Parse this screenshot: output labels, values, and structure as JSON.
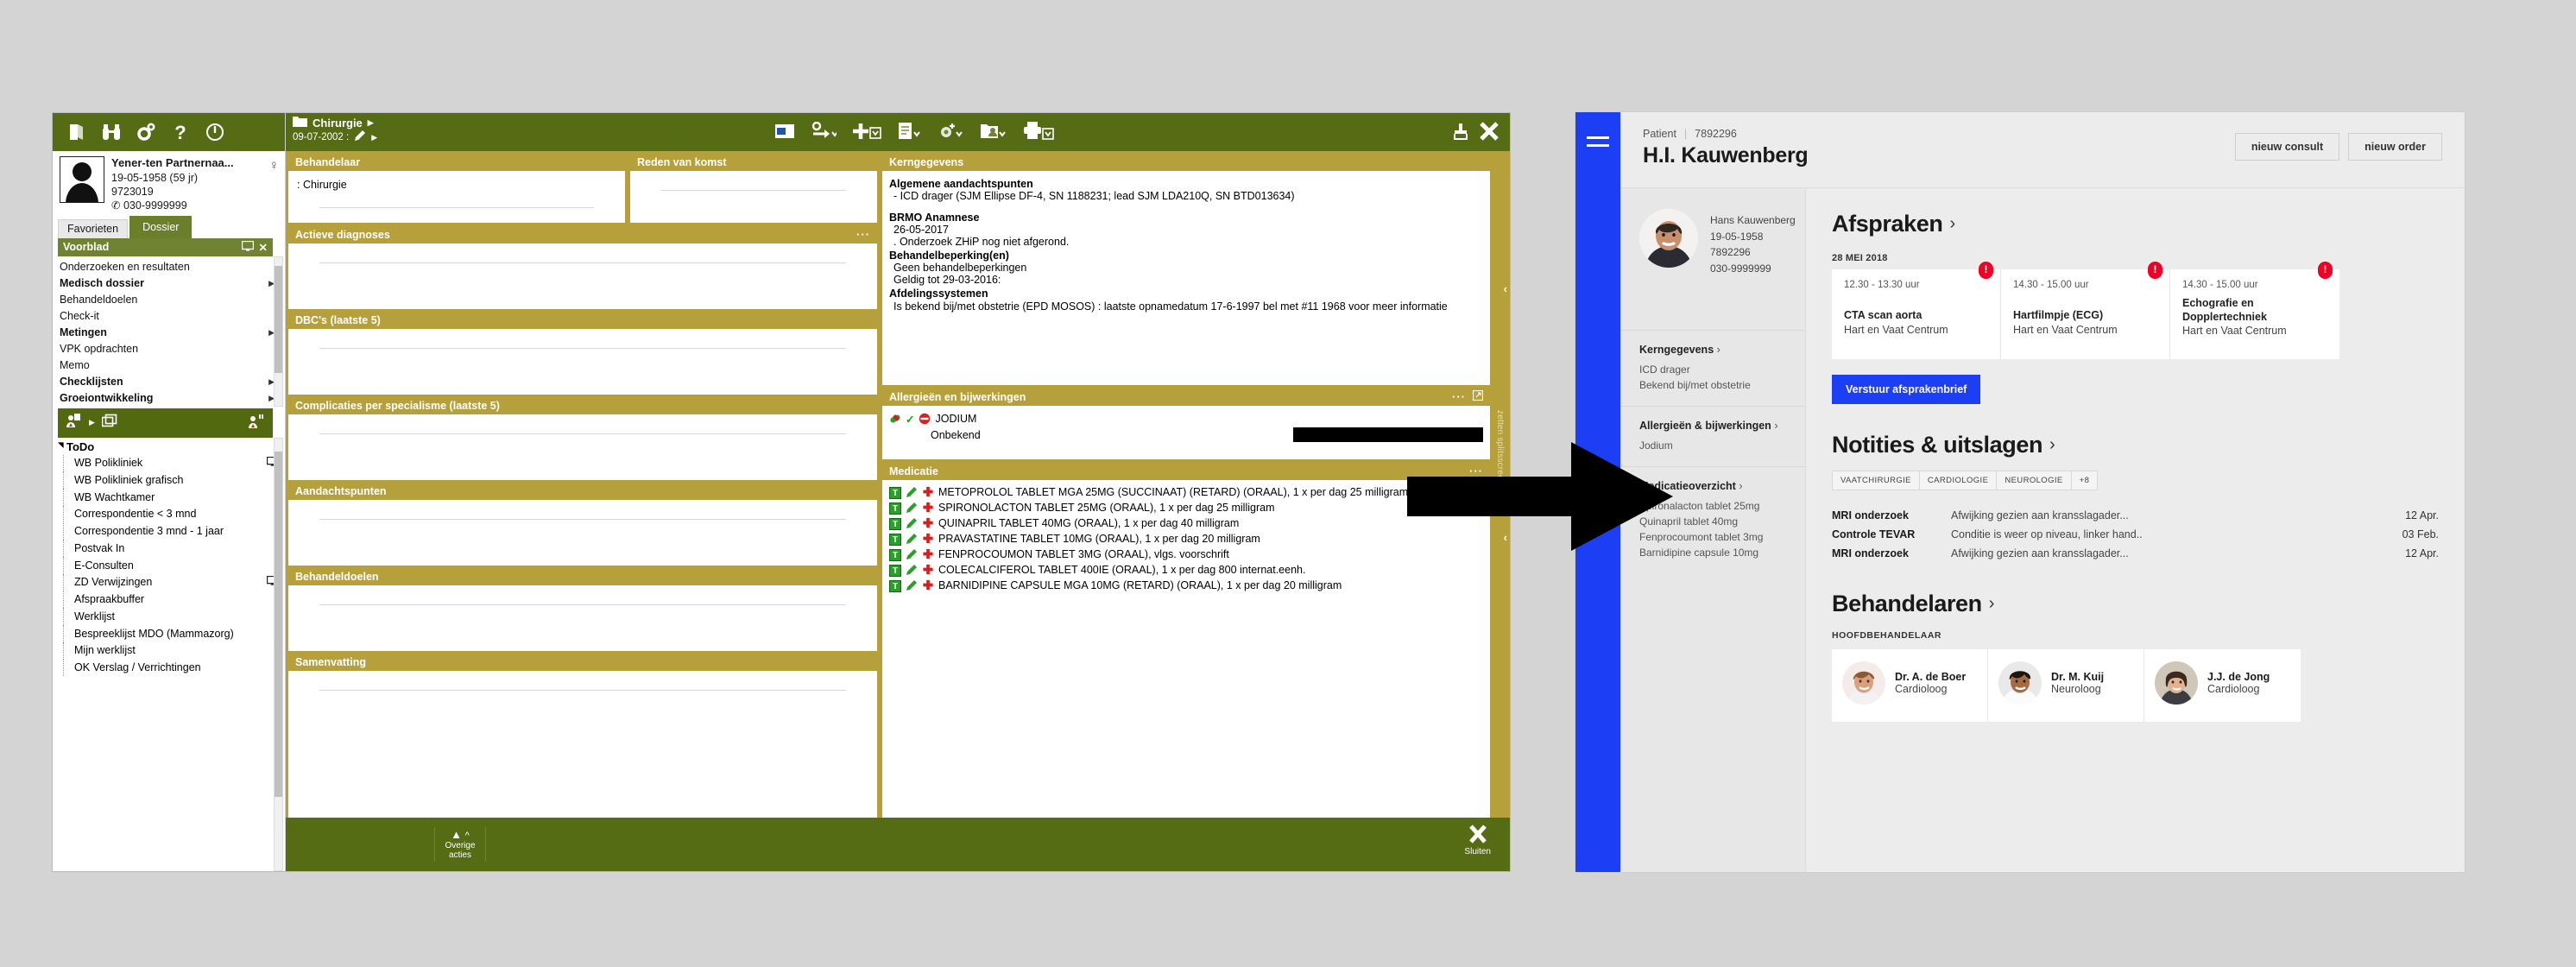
{
  "legacy": {
    "toolbar_icons": [
      "book-icon",
      "binoculars-icon",
      "gears-icon",
      "help-icon",
      "power-icon"
    ],
    "patient": {
      "name": "Yener-ten Partnernaa...",
      "dob": "19-05-1958 (59 jr)",
      "id": "9723019",
      "phone": "030-9999999",
      "phone_icon": "phone-icon",
      "gender_icon": "female-icon",
      "avatar": "patient-silhouette-avatar"
    },
    "tabs": [
      {
        "label": "Favorieten",
        "active": false
      },
      {
        "label": "Dossier",
        "active": true
      }
    ],
    "panel_header": {
      "title": "Voorblad",
      "screen_icon": "monitor-icon",
      "close_icon": "close-icon"
    },
    "nav_items": [
      {
        "label": "Onderzoeken en resultaten",
        "bold": false,
        "arrow": false
      },
      {
        "label": "Medisch dossier",
        "bold": true,
        "arrow": true
      },
      {
        "label": "Behandeldoelen",
        "bold": false,
        "arrow": false
      },
      {
        "label": "Check-it",
        "bold": false,
        "arrow": false
      },
      {
        "label": "Metingen",
        "bold": true,
        "arrow": true
      },
      {
        "label": "VPK opdrachten",
        "bold": false,
        "arrow": false
      },
      {
        "label": "Memo",
        "bold": false,
        "arrow": false
      },
      {
        "label": "Checklijsten",
        "bold": true,
        "arrow": true
      },
      {
        "label": "Groeiontwikkeling",
        "bold": true,
        "arrow": true
      }
    ],
    "green_bar_icons": [
      "patient-doc-icon",
      "chevron-right-icon",
      "copy-stack-icon",
      "patient-search-icon"
    ],
    "todo": {
      "title": "ToDo",
      "items": [
        {
          "label": "WB Polikliniek",
          "icon": "monitor-icon"
        },
        {
          "label": "WB Polikliniek grafisch",
          "icon": ""
        },
        {
          "label": "WB Wachtkamer",
          "icon": ""
        },
        {
          "label": "Correspondentie < 3 mnd",
          "icon": ""
        },
        {
          "label": "Correspondentie 3 mnd - 1 jaar",
          "icon": ""
        },
        {
          "label": "Postvak In",
          "icon": ""
        },
        {
          "label": "E-Consulten",
          "icon": ""
        },
        {
          "label": "ZD Verwijzingen",
          "icon": "monitor-icon"
        },
        {
          "label": "Afspraakbuffer",
          "icon": ""
        },
        {
          "label": "Werklijst",
          "icon": ""
        },
        {
          "label": "Bespreeklijst MDO (Mammazorg)",
          "icon": ""
        },
        {
          "label": "Mijn werklijst",
          "icon": ""
        },
        {
          "label": "OK Verslag / Verrichtingen",
          "icon": ""
        }
      ]
    },
    "main_header": {
      "folder_icon": "folder-icon",
      "breadcrumb_1": "Chirurgie",
      "breadcrumb_date": "09-07-2002 :",
      "pen_icon": "pen-icon",
      "tool_icons": [
        "file-window-icon",
        "person-go-icon",
        "plus-icon",
        "document-icon",
        "target-plus-icon",
        "person-card-icon",
        "printer-icon"
      ],
      "pin_icon": "pin-icon",
      "close_icon": "close-icon"
    },
    "columns": {
      "behandelaar": {
        "title": "Behandelaar",
        "value": ": Chirurgie"
      },
      "reden": {
        "title": "Reden van komst",
        "value": ""
      }
    },
    "sections_left": [
      {
        "title": "Actieve diagnoses",
        "dots": "···"
      },
      {
        "title": "DBC's (laatste 5)",
        "dots": ""
      },
      {
        "title": "Complicaties per specialisme (laatste 5)",
        "dots": ""
      },
      {
        "title": "Aandachtspunten",
        "dots": ""
      },
      {
        "title": "Behandeldoelen",
        "dots": ""
      },
      {
        "title": "Samenvatting",
        "dots": ""
      }
    ],
    "kerngegevens": {
      "title": "Kerngegevens",
      "lines": [
        {
          "text": "Algemene aandachtspunten",
          "bold": true
        },
        {
          "text": "- ICD drager (SJM Ellipse DF-4, SN 1188231; lead SJM LDA210Q, SN BTD013634)",
          "bold": false
        },
        {
          "text": "",
          "bold": false
        },
        {
          "text": "BRMO Anamnese",
          "bold": true
        },
        {
          "text": "26-05-2017",
          "bold": false
        },
        {
          "text": ". Onderzoek ZHiP nog niet afgerond.",
          "bold": false
        },
        {
          "text": "Behandelbeperking(en)",
          "bold": true
        },
        {
          "text": "Geen behandelbeperkingen",
          "bold": false
        },
        {
          "text": "Geldig tot 29-03-2016:",
          "bold": false
        },
        {
          "text": "Afdelingssystemen",
          "bold": true
        },
        {
          "text": "Is bekend bij/met obstetrie (EPD MOSOS) : laatste opnamedatum 17-6-1997 bel met #11 1968 voor meer informatie",
          "bold": false
        }
      ]
    },
    "allergies": {
      "title": "Allergieën en bijwerkingen",
      "dots": "···",
      "expand_icon": "expand-icon",
      "item": "JODIUM",
      "sub": "Onbekend",
      "icons": [
        "pill-icon",
        "check-icon",
        "no-entry-icon"
      ]
    },
    "medication": {
      "title": "Medicatie",
      "dots": "···",
      "items": [
        "METOPROLOL TABLET MGA  25MG (SUCCINAAT) (RETARD)  (ORAAL), 1 x per dag 25 milligram",
        "SPIRONOLACTON TABLET 25MG  (ORAAL), 1 x per dag 25 milligram",
        "QUINAPRIL TABLET 40MG  (ORAAL), 1 x per dag 40 milligram",
        "PRAVASTATINE TABLET 10MG  (ORAAL), 1 x per dag 20 milligram",
        "FENPROCOUMON TABLET 3MG  (ORAAL), vlgs. voorschrift",
        "COLECALCIFEROL TABLET  400IE  (ORAAL), 1 x per dag 800 internat.eenh.",
        "BARNIDIPINE CAPSULE MGA 10MG (RETARD)  (ORAAL), 1 x per dag 20 milligram"
      ],
      "row_badge": "T",
      "row_icons": [
        "pencil-icon",
        "red-cross-icon"
      ]
    },
    "rail": {
      "vertical_text": "zetten splitsscreen",
      "chevron": "‹"
    },
    "footer": {
      "more_actions": "Overige acties",
      "more_actions_icon": "triangle-up-icon",
      "close_label": "Sluiten",
      "close_icon": "close-icon"
    }
  },
  "arrow": {
    "name": "transition-arrow"
  },
  "modern": {
    "menu_icon": "hamburger-menu-icon",
    "patient_label": "Patient",
    "patient_number": "7892296",
    "patient_title": "H.I. Kauwenberg",
    "actions": [
      {
        "label": "nieuw consult"
      },
      {
        "label": "nieuw order"
      }
    ],
    "sidebar": {
      "photo": "patient-photo",
      "name": "Hans Kauwenberg",
      "dob": "19-05-1958",
      "id": "7892296",
      "phone": "030-9999999",
      "blocks": [
        {
          "title": "Kerngegevens",
          "lines": [
            "ICD drager",
            "Bekend bij/met obstetrie"
          ]
        },
        {
          "title": "Allergieën & bijwerkingen",
          "lines": [
            "Jodium"
          ]
        },
        {
          "title": "Medicatieoverzicht",
          "lines": [
            "Spironalacton tablet 25mg",
            "Quinapril tablet 40mg",
            "Fenprocoumont tablet 3mg",
            "Barnidipine capsule 10mg"
          ]
        }
      ]
    },
    "appointments": {
      "heading": "Afspraken",
      "chevron": "›",
      "date_label": "28 MEI 2018",
      "items": [
        {
          "time": "12.30 - 13.30 uur",
          "title": "CTA scan aorta",
          "location": "Hart en Vaat Centrum",
          "alert": "!"
        },
        {
          "time": "14.30 - 15.00 uur",
          "title": "Hartfilmpje (ECG)",
          "location": "Hart en Vaat Centrum",
          "alert": "!"
        },
        {
          "time": "14.30 - 15.00 uur",
          "title": "Echografie en Dopplertechniek",
          "location": "Hart en Vaat Centrum",
          "alert": "!"
        }
      ],
      "cta": "Verstuur afsprakenbrief"
    },
    "notes": {
      "heading": "Notities & uitslagen",
      "chevron": "›",
      "chips": [
        "VAATCHIRURGIE",
        "CARDIOLOGIE",
        "NEUROLOGIE",
        "+8"
      ],
      "items": [
        {
          "name": "MRI onderzoek",
          "desc": "Afwijking gezien aan kransslagader...",
          "date": "12 Apr."
        },
        {
          "name": "Controle TEVAR",
          "desc": "Conditie is weer op niveau, linker hand..",
          "date": "03 Feb."
        },
        {
          "name": "MRI onderzoek",
          "desc": "Afwijking gezien aan kransslagader...",
          "date": "12 Apr."
        }
      ]
    },
    "practitioners": {
      "heading": "Behandelaren",
      "chevron": "›",
      "subheading": "HOOFDBEHANDELAAR",
      "items": [
        {
          "name": "Dr. A. de Boer",
          "role": "Cardioloog",
          "photo": "doctor-photo-1"
        },
        {
          "name": "Dr. M. Kuij",
          "role": "Neuroloog",
          "photo": "doctor-photo-2"
        },
        {
          "name": "J.J. de Jong",
          "role": "Cardioloog",
          "photo": "doctor-photo-3"
        }
      ]
    }
  },
  "colors": {
    "legacy_green": "#556b14",
    "legacy_green_light": "#6f8332",
    "legacy_gold": "#b5a03c",
    "modern_blue": "#1c3ef5",
    "alert_red": "#ef0025",
    "page_bg": "#d4d4d4"
  }
}
